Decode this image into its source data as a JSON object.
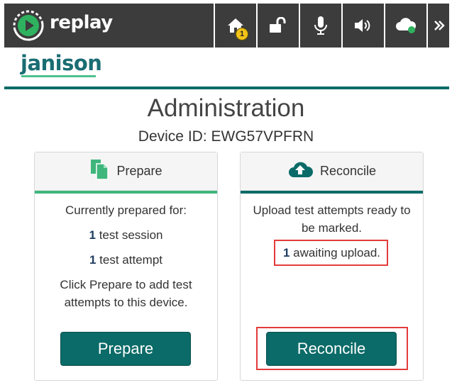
{
  "app": {
    "brand": "replay"
  },
  "topbar": {
    "home_badge": "1",
    "icons": [
      "home-icon",
      "unlock-icon",
      "microphone-icon",
      "speaker-icon",
      "cloud-status-icon",
      "chevron-double-right-icon"
    ]
  },
  "org": {
    "name": "janison"
  },
  "page": {
    "title": "Administration",
    "device_id": "Device ID: EWG57VPFRN"
  },
  "prepare": {
    "heading": "Prepare",
    "line1": "Currently prepared for:",
    "sessions_count": "1",
    "sessions_label": " test session",
    "attempts_count": "1",
    "attempts_label": " test attempt",
    "hint_line1": "Click Prepare to add test",
    "hint_line2": "attempts to this device.",
    "button_label": "Prepare"
  },
  "reconcile": {
    "heading": "Reconcile",
    "line1": "Upload test attempts ready to",
    "line2": "be marked.",
    "awaiting_count": "1",
    "awaiting_label": " awaiting upload.",
    "button_label": "Reconcile"
  },
  "colors": {
    "topbar": "#3c3c3c",
    "brand_teal": "#0b6b68",
    "accent_green": "#3fb67c",
    "highlight_red": "#e33b3b",
    "badge_yellow": "#f2c218"
  }
}
